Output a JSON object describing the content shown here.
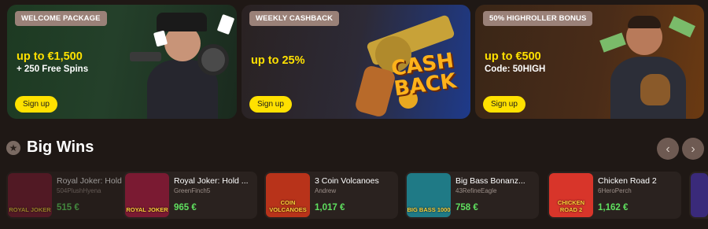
{
  "promos": [
    {
      "badge": "WELCOME PACKAGE",
      "title": "up to €1,500",
      "sub": "+ 250 Free Spins",
      "button": "Sign up"
    },
    {
      "badge": "WEEKLY CASHBACK",
      "title": "up to 25%",
      "sub": "",
      "button": "Sign up",
      "art_text": "CASH BACK"
    },
    {
      "badge": "50% HIGHROLLER BONUS",
      "title": "up to €500",
      "sub": "Code: 50HIGH",
      "button": "Sign up"
    }
  ],
  "section": {
    "title": "Big Wins",
    "prev": "‹",
    "next": "›"
  },
  "wins": [
    {
      "game": "Royal Joker: Hold",
      "player": "504PlushHyena",
      "amount": "515 €",
      "thumb_text": "ROYAL JOKER",
      "thumb_color": "#7a1a32"
    },
    {
      "game": "Royal Joker: Hold ...",
      "player": "GreenFinch5",
      "amount": "965 €",
      "thumb_text": "ROYAL JOKER",
      "thumb_color": "#7a1a32"
    },
    {
      "game": "3 Coin Volcanoes",
      "player": "Andrew",
      "amount": "1,017 €",
      "thumb_text": "COIN VOLCANOES",
      "thumb_color": "#b8331a"
    },
    {
      "game": "Big Bass Bonanz...",
      "player": "43RefineEagle",
      "amount": "758 €",
      "thumb_text": "BIG BASS 1000",
      "thumb_color": "#1f7a86"
    },
    {
      "game": "Chicken Road 2",
      "player": "6HeroPerch",
      "amount": "1,162 €",
      "thumb_text": "CHICKEN ROAD 2",
      "thumb_color": "#d8352a"
    }
  ],
  "colors": {
    "accent": "#ffe100",
    "win_green": "#5fe05f",
    "background": "#1f1815",
    "card": "#2a221f"
  }
}
